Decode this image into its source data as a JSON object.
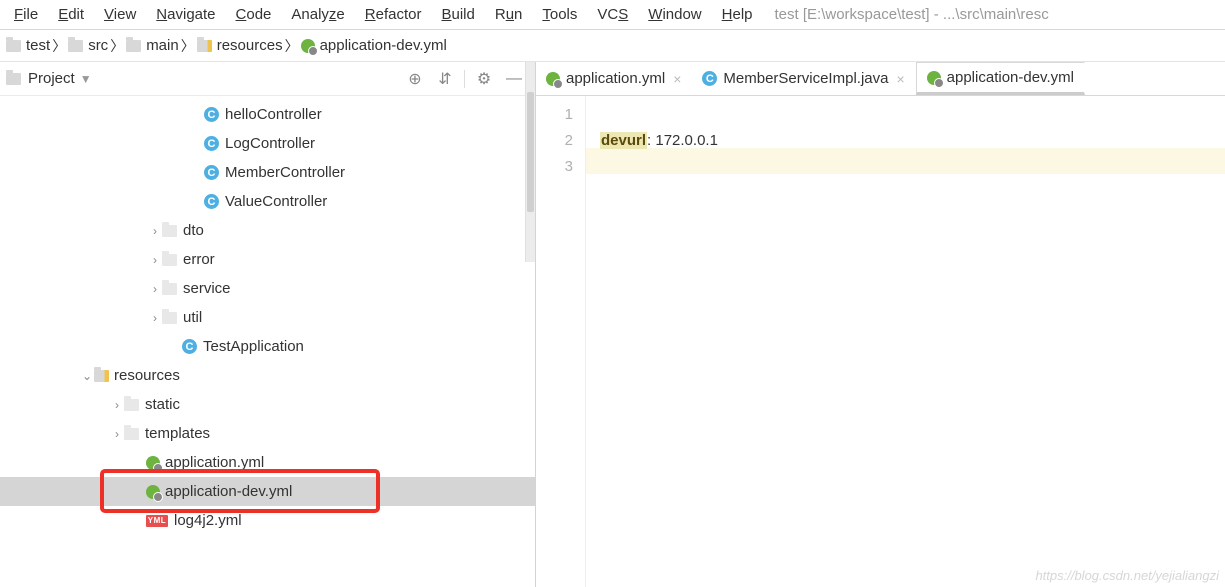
{
  "menu": {
    "items": [
      {
        "pre": "",
        "u": "F",
        "post": "ile"
      },
      {
        "pre": "",
        "u": "E",
        "post": "dit"
      },
      {
        "pre": "",
        "u": "V",
        "post": "iew"
      },
      {
        "pre": "",
        "u": "N",
        "post": "avigate"
      },
      {
        "pre": "",
        "u": "C",
        "post": "ode"
      },
      {
        "pre": "Analy",
        "u": "z",
        "post": "e"
      },
      {
        "pre": "",
        "u": "R",
        "post": "efactor"
      },
      {
        "pre": "",
        "u": "B",
        "post": "uild"
      },
      {
        "pre": "R",
        "u": "u",
        "post": "n"
      },
      {
        "pre": "",
        "u": "T",
        "post": "ools"
      },
      {
        "pre": "VC",
        "u": "S",
        "post": ""
      },
      {
        "pre": "",
        "u": "W",
        "post": "indow"
      },
      {
        "pre": "",
        "u": "H",
        "post": "elp"
      }
    ],
    "title": "test [E:\\workspace\\test] - ...\\src\\main\\resc"
  },
  "breadcrumb": [
    "test",
    "src",
    "main",
    "resources",
    "application-dev.yml"
  ],
  "project": {
    "label": "Project",
    "tree": [
      {
        "indent": 190,
        "icon": "class",
        "label": "helloController"
      },
      {
        "indent": 190,
        "icon": "class",
        "label": "LogController"
      },
      {
        "indent": 190,
        "icon": "class",
        "label": "MemberController"
      },
      {
        "indent": 190,
        "icon": "class",
        "label": "ValueController"
      },
      {
        "indent": 148,
        "arrow": ">",
        "icon": "dimfolder",
        "label": "dto"
      },
      {
        "indent": 148,
        "arrow": ">",
        "icon": "dimfolder",
        "label": "error"
      },
      {
        "indent": 148,
        "arrow": ">",
        "icon": "dimfolder",
        "label": "service"
      },
      {
        "indent": 148,
        "arrow": ">",
        "icon": "dimfolder",
        "label": "util"
      },
      {
        "indent": 168,
        "icon": "classrun",
        "label": "TestApplication"
      },
      {
        "indent": 80,
        "arrow": "v",
        "icon": "resfolder",
        "label": "resources"
      },
      {
        "indent": 110,
        "arrow": ">",
        "icon": "dimfolder",
        "label": "static"
      },
      {
        "indent": 110,
        "arrow": ">",
        "icon": "dimfolder",
        "label": "templates"
      },
      {
        "indent": 132,
        "icon": "spring",
        "label": "application.yml"
      },
      {
        "indent": 132,
        "icon": "spring",
        "label": "application-dev.yml",
        "selected": true
      },
      {
        "indent": 132,
        "icon": "yml",
        "label": "log4j2.yml"
      }
    ]
  },
  "editor": {
    "tabs": [
      {
        "icon": "spring",
        "label": "application.yml",
        "active": false
      },
      {
        "icon": "class",
        "label": "MemberServiceImpl.java",
        "active": false
      },
      {
        "icon": "spring",
        "label": "application-dev.yml",
        "active": true,
        "noclose": true
      }
    ],
    "lines": [
      "1",
      "2",
      "3"
    ],
    "code_key": "devurl",
    "code_sep": ": ",
    "code_val": "172.0.0.1"
  },
  "watermark": "https://blog.csdn.net/yejialiangzi"
}
